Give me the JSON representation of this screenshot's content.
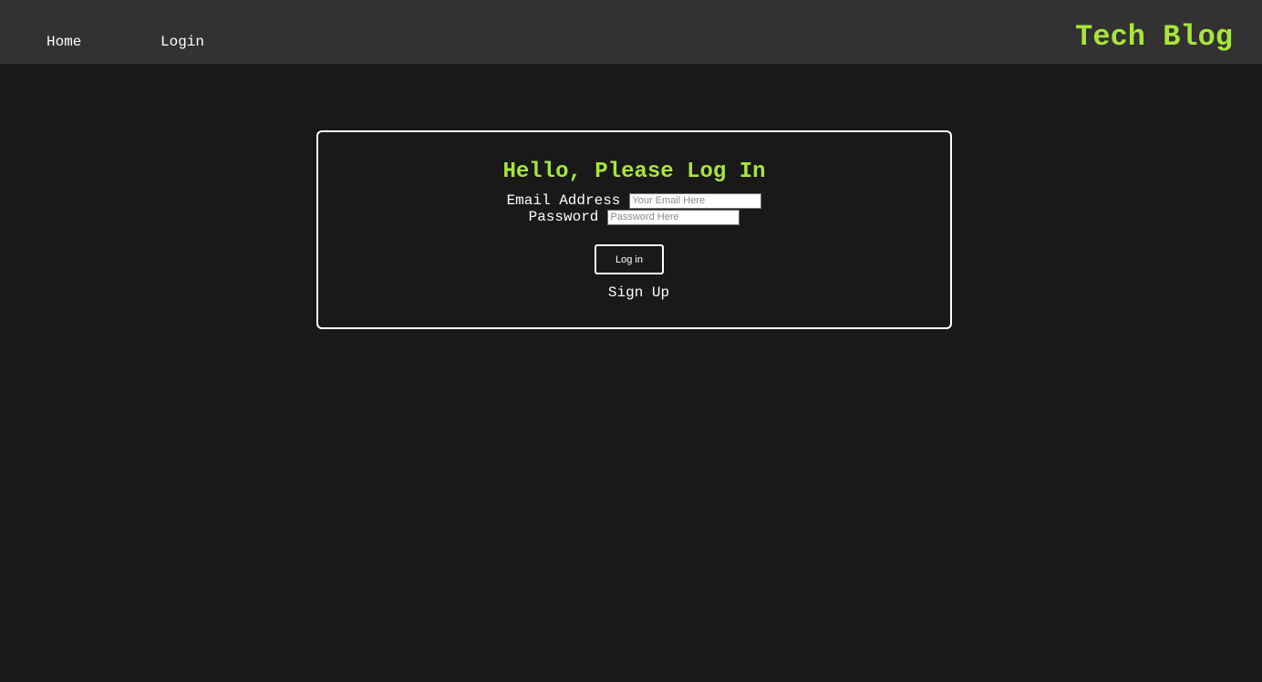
{
  "header": {
    "nav": [
      {
        "label": "Home"
      },
      {
        "label": "Login"
      }
    ],
    "brand": "Tech Blog"
  },
  "login_form": {
    "title": "Hello, Please Log In",
    "email": {
      "label": "Email Address",
      "placeholder": "Your Email Here",
      "value": ""
    },
    "password": {
      "label": "Password",
      "placeholder": "Password Here",
      "value": ""
    },
    "submit_label": "Log in",
    "signup_label": "Sign Up"
  },
  "colors": {
    "background": "#191919",
    "navbar": "#333132",
    "accent": "#a8e63a",
    "text": "#ffffff"
  }
}
